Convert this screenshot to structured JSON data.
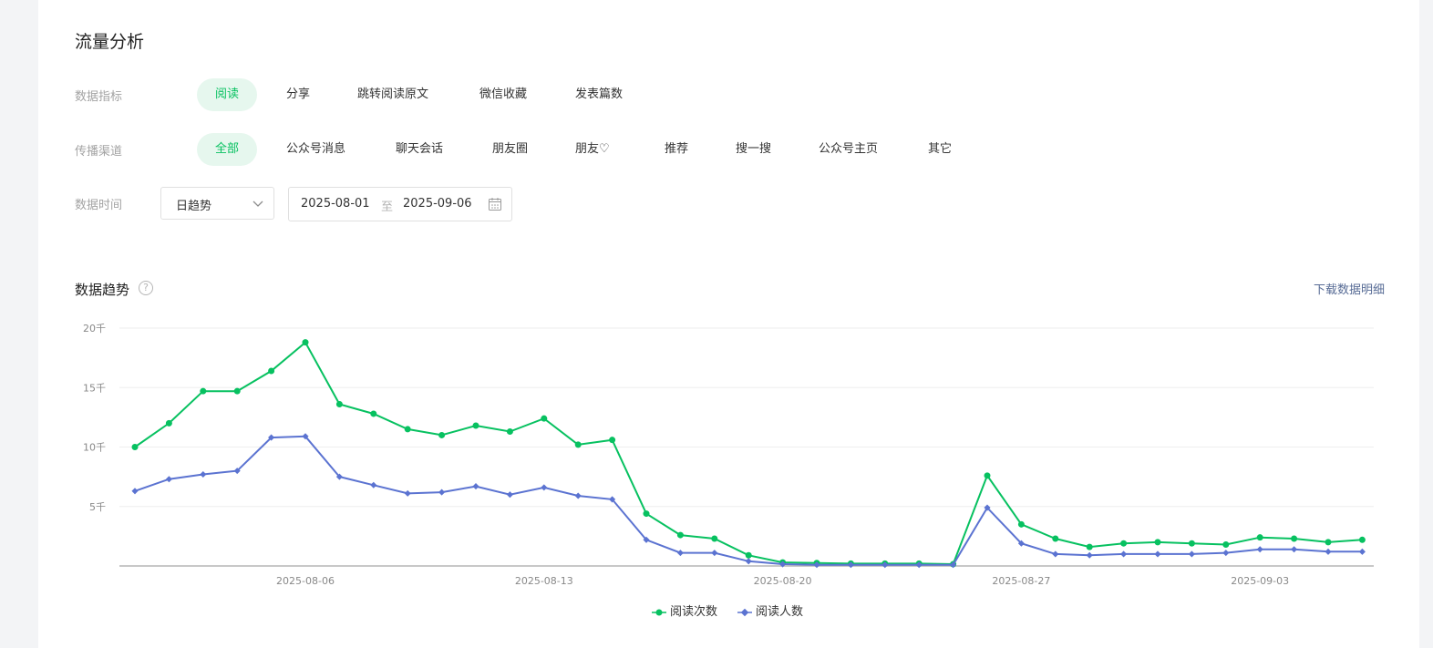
{
  "page": {
    "title": "流量分析"
  },
  "filters": {
    "metric": {
      "label": "数据指标",
      "options": [
        "阅读",
        "分享",
        "跳转阅读原文",
        "微信收藏",
        "发表篇数"
      ],
      "active_index": 0
    },
    "channel": {
      "label": "传播渠道",
      "options": [
        "全部",
        "公众号消息",
        "聊天会话",
        "朋友圈",
        "朋友♡",
        "推荐",
        "搜一搜",
        "公众号主页",
        "其它"
      ],
      "active_index": 0
    },
    "time": {
      "label": "数据时间",
      "granularity": "日趋势",
      "start_date": "2025-08-01",
      "separator": "至",
      "end_date": "2025-09-06"
    }
  },
  "trend": {
    "title": "数据趋势",
    "help": "?",
    "download_label": "下载数据明细"
  },
  "colors": {
    "accent": "#07c160",
    "series_reads": "#07c160",
    "series_readers": "#5b73d1",
    "link": "#576b95"
  },
  "icons": {
    "select": "chevron-down-icon",
    "date": "calendar-icon",
    "help": "help-circle-icon"
  },
  "chart_data": {
    "type": "line",
    "x": [
      "2025-08-01",
      "2025-08-02",
      "2025-08-03",
      "2025-08-04",
      "2025-08-05",
      "2025-08-06",
      "2025-08-07",
      "2025-08-08",
      "2025-08-09",
      "2025-08-10",
      "2025-08-11",
      "2025-08-12",
      "2025-08-13",
      "2025-08-14",
      "2025-08-15",
      "2025-08-16",
      "2025-08-17",
      "2025-08-18",
      "2025-08-19",
      "2025-08-20",
      "2025-08-21",
      "2025-08-22",
      "2025-08-23",
      "2025-08-24",
      "2025-08-25",
      "2025-08-26",
      "2025-08-27",
      "2025-08-28",
      "2025-08-29",
      "2025-08-30",
      "2025-08-31",
      "2025-09-01",
      "2025-09-02",
      "2025-09-03",
      "2025-09-04",
      "2025-09-05",
      "2025-09-06"
    ],
    "x_tick_labels": [
      "2025-08-06",
      "2025-08-13",
      "2025-08-20",
      "2025-08-27",
      "2025-09-03"
    ],
    "y_ticks": [
      5000,
      10000,
      15000,
      20000
    ],
    "y_tick_labels": [
      "5千",
      "10千",
      "15千",
      "20千"
    ],
    "ylim": [
      0,
      20000
    ],
    "series": [
      {
        "name": "阅读次数",
        "marker": "circle",
        "values": [
          10000,
          12000,
          14700,
          14700,
          16400,
          18800,
          13600,
          12800,
          11500,
          11000,
          11800,
          11300,
          12400,
          10200,
          10600,
          4400,
          2600,
          2300,
          900,
          300,
          250,
          200,
          200,
          200,
          150,
          7600,
          3500,
          2300,
          1600,
          1900,
          2000,
          1900,
          1800,
          2400,
          2300,
          2000,
          2200
        ]
      },
      {
        "name": "阅读人数",
        "marker": "diamond",
        "values": [
          6300,
          7300,
          7700,
          8000,
          10800,
          10900,
          7500,
          6800,
          6100,
          6200,
          6700,
          6000,
          6600,
          5900,
          5600,
          2200,
          1100,
          1100,
          400,
          150,
          100,
          100,
          100,
          100,
          100,
          4900,
          1900,
          1000,
          900,
          1000,
          1000,
          1000,
          1100,
          1400,
          1400,
          1200,
          1200
        ]
      }
    ],
    "grid": true,
    "legend_position": "bottom-center"
  }
}
